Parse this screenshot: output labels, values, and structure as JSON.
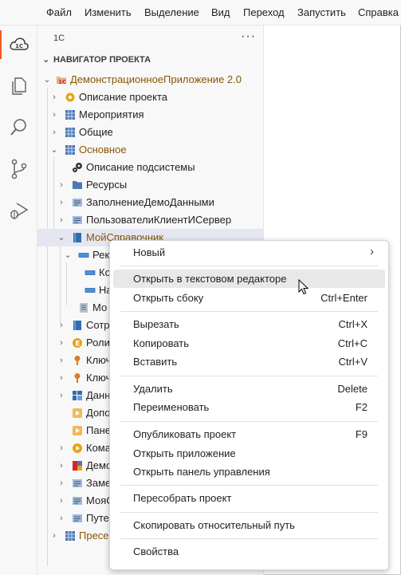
{
  "menubar": {
    "items": [
      "Файл",
      "Изменить",
      "Выделение",
      "Вид",
      "Переход",
      "Запустить",
      "Справка"
    ]
  },
  "activity_bar": {
    "icons": [
      "1c-logo-icon",
      "files-icon",
      "search-icon",
      "source-control-icon",
      "run-debug-icon"
    ]
  },
  "sidebar": {
    "title": "1C",
    "more": "···",
    "section_title": "НАВИГАТОР ПРОЕКТА",
    "tree": [
      {
        "label": "ДемонстрационноеПриложение 2.0",
        "icon": "project-1c-icon"
      },
      {
        "label": "Описание проекта",
        "icon": "gear-icon"
      },
      {
        "label": "Мероприятия",
        "icon": "subsystem-icon"
      },
      {
        "label": "Общие",
        "icon": "subsystem-icon"
      },
      {
        "label": "Основное",
        "icon": "subsystem-icon"
      },
      {
        "label": "Описание подсистемы",
        "icon": "gears-icon"
      },
      {
        "label": "Ресурсы",
        "icon": "folder-icon"
      },
      {
        "label": "ЗаполнениеДемоДанными",
        "icon": "module-icon"
      },
      {
        "label": "ПользователиКлиентИСервер",
        "icon": "module-icon"
      },
      {
        "label": "МойСправочник",
        "icon": "catalog-icon"
      },
      {
        "label": "Рек",
        "icon": "attribute-icon"
      },
      {
        "label": "Ко",
        "icon": "attribute-icon"
      },
      {
        "label": "На",
        "icon": "attribute-icon"
      },
      {
        "label": "Мо",
        "icon": "document-icon"
      },
      {
        "label": "Сотр",
        "icon": "catalog-icon"
      },
      {
        "label": "Роли",
        "icon": "enum-icon"
      },
      {
        "label": "Ключ",
        "icon": "key-icon"
      },
      {
        "label": "Ключ",
        "icon": "key-icon"
      },
      {
        "label": "Данн",
        "icon": "register-icon"
      },
      {
        "label": "Допо",
        "icon": "form-icon"
      },
      {
        "label": "Пане",
        "icon": "form-icon"
      },
      {
        "label": "Кома",
        "icon": "command-icon"
      },
      {
        "label": "Демо",
        "icon": "dashboard-icon"
      },
      {
        "label": "Заме",
        "icon": "module-icon"
      },
      {
        "label": "МояС",
        "icon": "module-icon"
      },
      {
        "label": "Путе",
        "icon": "module-icon"
      },
      {
        "label": "Пресе",
        "icon": "subsystem-icon"
      }
    ]
  },
  "context_menu": {
    "items": [
      {
        "label": "Новый",
        "shortcut": "",
        "submenu": "›"
      },
      {
        "label": "Открыть в текстовом редакторе",
        "shortcut": ""
      },
      {
        "label": "Открыть сбоку",
        "shortcut": "Ctrl+Enter"
      },
      {
        "label": "Вырезать",
        "shortcut": "Ctrl+X"
      },
      {
        "label": "Копировать",
        "shortcut": "Ctrl+C"
      },
      {
        "label": "Вставить",
        "shortcut": "Ctrl+V"
      },
      {
        "label": "Удалить",
        "shortcut": "Delete"
      },
      {
        "label": "Переименовать",
        "shortcut": "F2"
      },
      {
        "label": "Опубликовать проект",
        "shortcut": "F9"
      },
      {
        "label": "Открыть приложение",
        "shortcut": ""
      },
      {
        "label": "Открыть панель управления",
        "shortcut": ""
      },
      {
        "label": "Пересобрать проект",
        "shortcut": ""
      },
      {
        "label": "Скопировать относительный путь",
        "shortcut": ""
      },
      {
        "label": "Свойства",
        "shortcut": ""
      }
    ]
  },
  "colors": {
    "accent": "#f05a22",
    "modified_text": "#895503",
    "selection": "#e4e6f1",
    "hover": "#e8e8e8"
  }
}
